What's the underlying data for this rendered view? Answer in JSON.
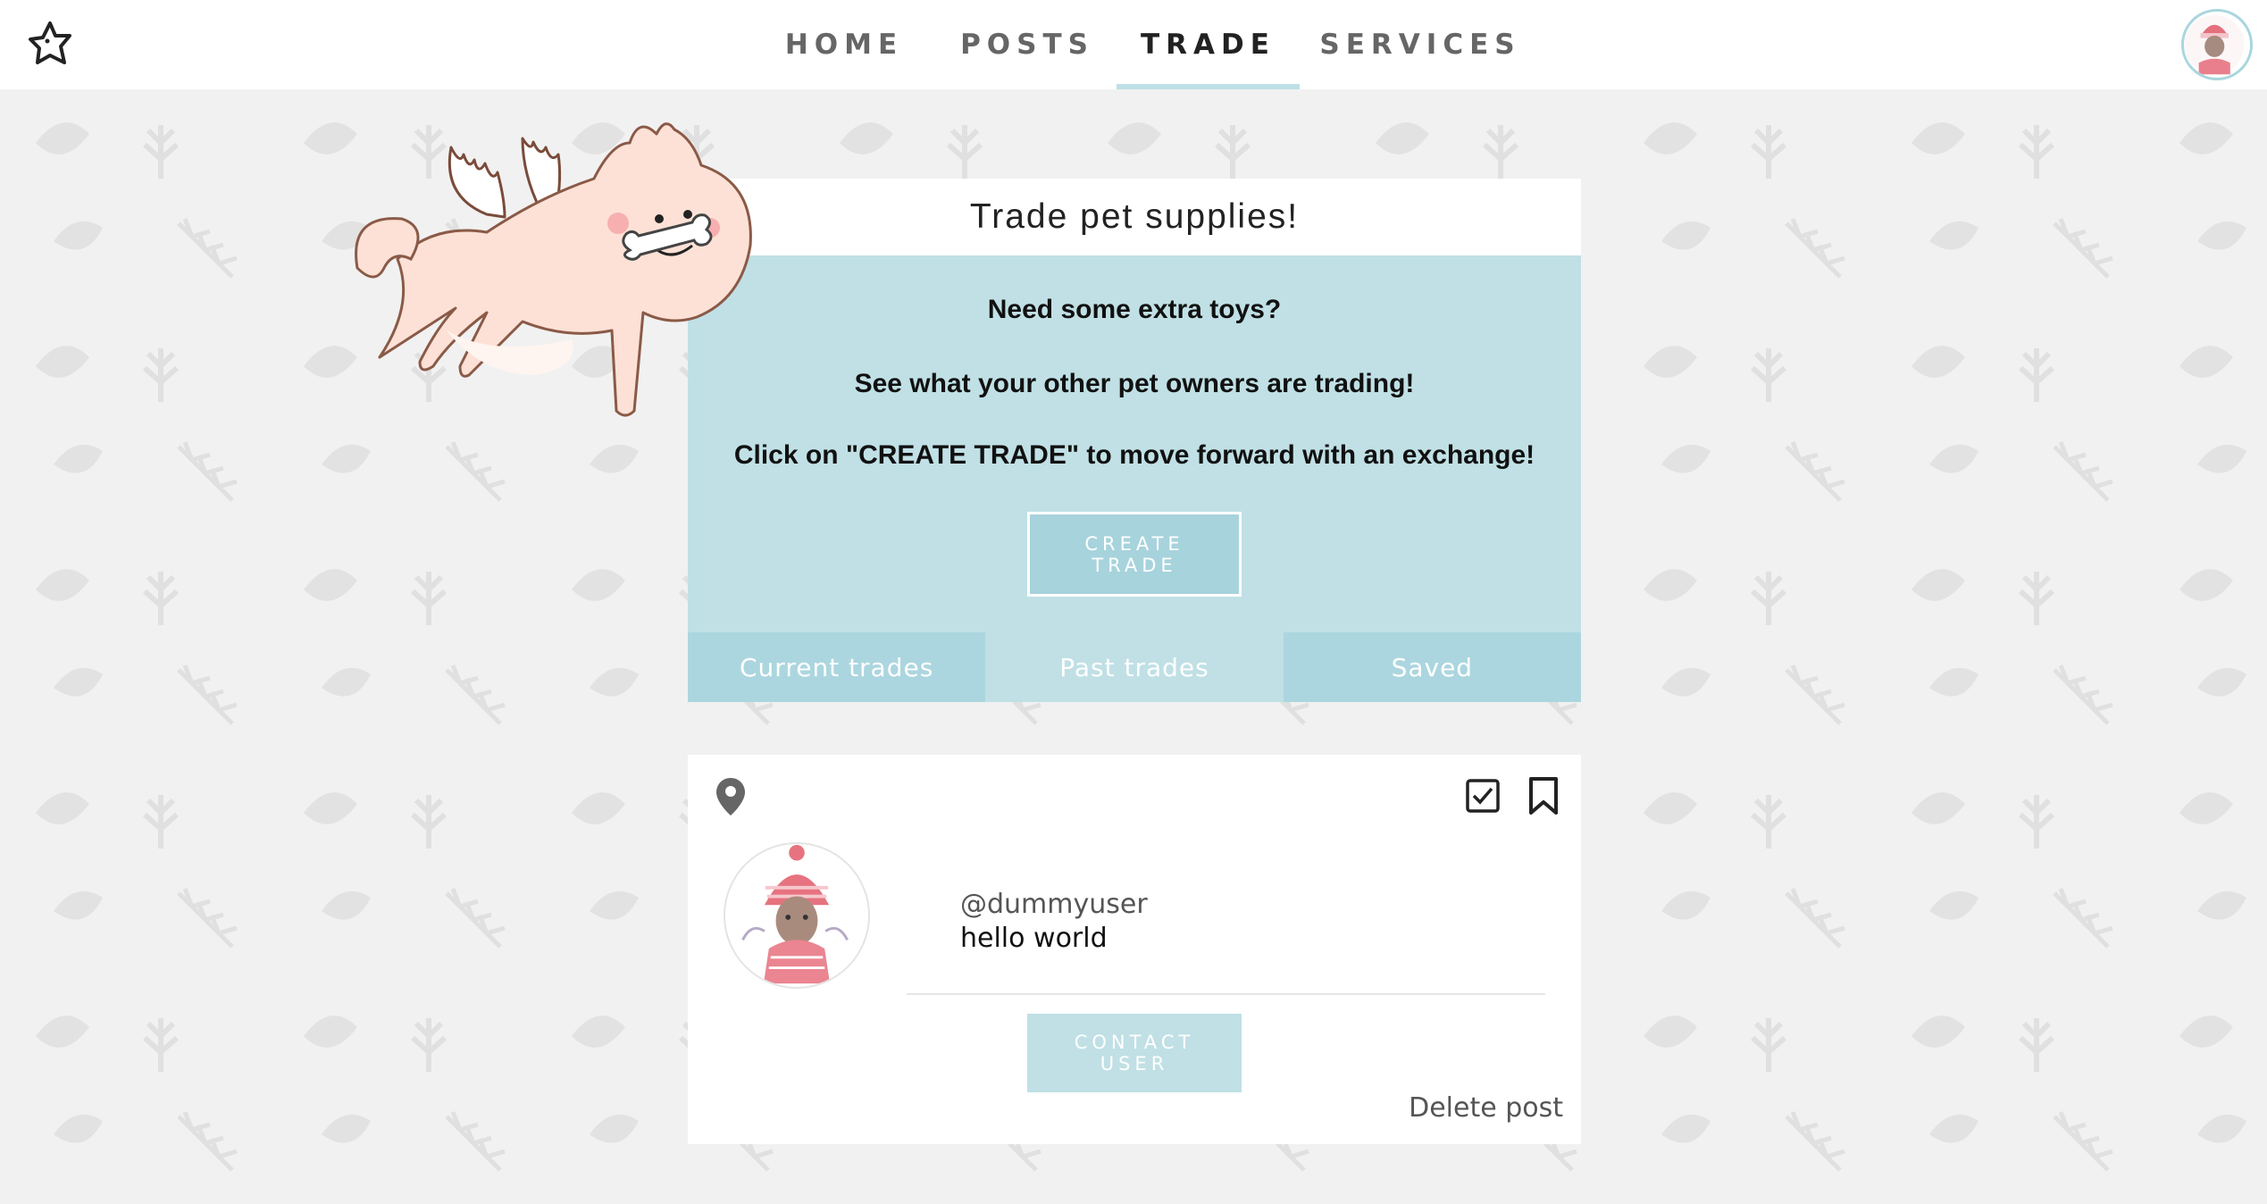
{
  "nav": {
    "items": [
      {
        "label": "HOME"
      },
      {
        "label": "POSTS"
      },
      {
        "label": "TRADE"
      },
      {
        "label": "SERVICES"
      }
    ],
    "active": "TRADE"
  },
  "hero": {
    "title": "Trade pet supplies!",
    "line1": "Need some extra toys?",
    "line2": "See what your other pet owners are trading!",
    "line3": "Click on \"CREATE TRADE\" to move forward with an exchange!",
    "create_line1": "CREATE",
    "create_line2": "TRADE"
  },
  "tabs": [
    "Current trades",
    "Past trades",
    "Saved"
  ],
  "post": {
    "username": "@dummyuser",
    "text": "hello world",
    "contact_line1": "CONTACT",
    "contact_line2": "USER",
    "delete_label": "Delete post"
  },
  "icons": {
    "logo": "dog-star-logo-icon",
    "location": "location-pin-icon",
    "check": "checkbox-checked-icon",
    "bookmark": "bookmark-icon"
  },
  "colors": {
    "accent": "#c0e0e5",
    "tab": "#acd6df",
    "background": "#f1f1f1"
  }
}
